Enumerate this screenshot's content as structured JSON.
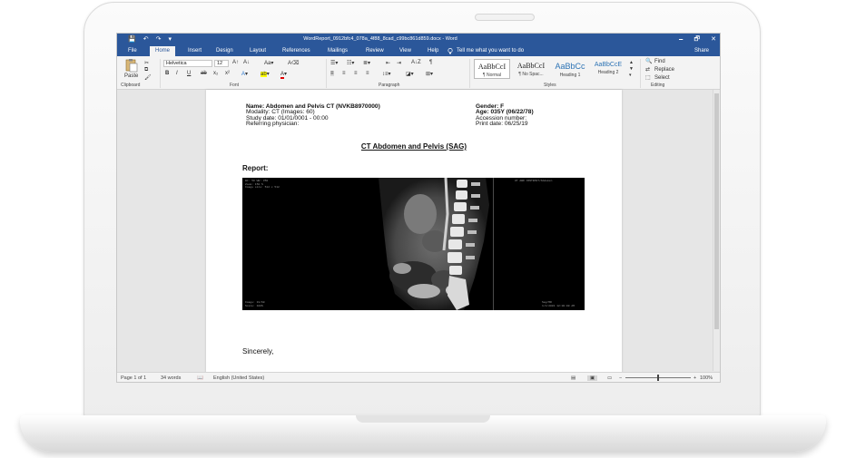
{
  "window": {
    "title": "WordReport_0912bfc4_078a_4f88_8cad_c99bc861d859.docx - Word",
    "qat": [
      "💾",
      "↶",
      "↷",
      "▾"
    ],
    "controls": [
      "🗕",
      "🗗",
      "✕"
    ]
  },
  "tabs": [
    "File",
    "Home",
    "Insert",
    "Design",
    "Layout",
    "References",
    "Mailings",
    "Review",
    "View",
    "Help"
  ],
  "tell_me": "Tell me what you want to do",
  "share": "Share",
  "ribbon": {
    "clipboard": {
      "paste": "Paste",
      "label": "Clipboard"
    },
    "font": {
      "name": "Helvetica",
      "size": "12",
      "label": "Font",
      "buttons": [
        "B",
        "I",
        "U",
        "ab",
        "x₂",
        "x²"
      ]
    },
    "paragraph": {
      "label": "Paragraph"
    },
    "styles": {
      "label": "Styles",
      "items": [
        {
          "sample": "AaBbCcI",
          "name": "¶ Normal"
        },
        {
          "sample": "AaBbCcI",
          "name": "¶ No Spac..."
        },
        {
          "sample": "AaBbCc",
          "name": "Heading 1"
        },
        {
          "sample": "AaBbCcE",
          "name": "Heading 2"
        }
      ]
    },
    "editing": {
      "label": "Editing",
      "find": "Find",
      "replace": "Replace",
      "select": "Select"
    }
  },
  "document": {
    "left_lines": [
      "Name: Abdomen and Pelvis CT (NVKB8970000)",
      "Modality: CT (Images: 60)",
      "Study date: 01/01/0001 - 00:00",
      "Referring physician:"
    ],
    "right_lines": [
      "Gender: F",
      "Age: 035Y (06/22/78)",
      "Accession number:",
      "Print date: 06/25/19"
    ],
    "title": "CT Abdomen and Pelvis (SAG)",
    "report_label": "Report:",
    "closing": "Sincerely,"
  },
  "ct_overlay": {
    "top_left": [
      "WC: 50 WW: 350",
      "Zoom: 150 %",
      "Image size: 512 x 512"
    ],
    "top_right": "UT ABD CONTRAST/Abdomen",
    "bottom_left": [
      "Image: 31/60",
      "Scale: 100%"
    ],
    "bottom_right": [
      "Sag/MR",
      "1/1/2001 12:00:00 AM"
    ]
  },
  "status": {
    "page": "Page 1 of 1",
    "words": "34 words",
    "language": "English (United States)",
    "zoom": "100%"
  }
}
